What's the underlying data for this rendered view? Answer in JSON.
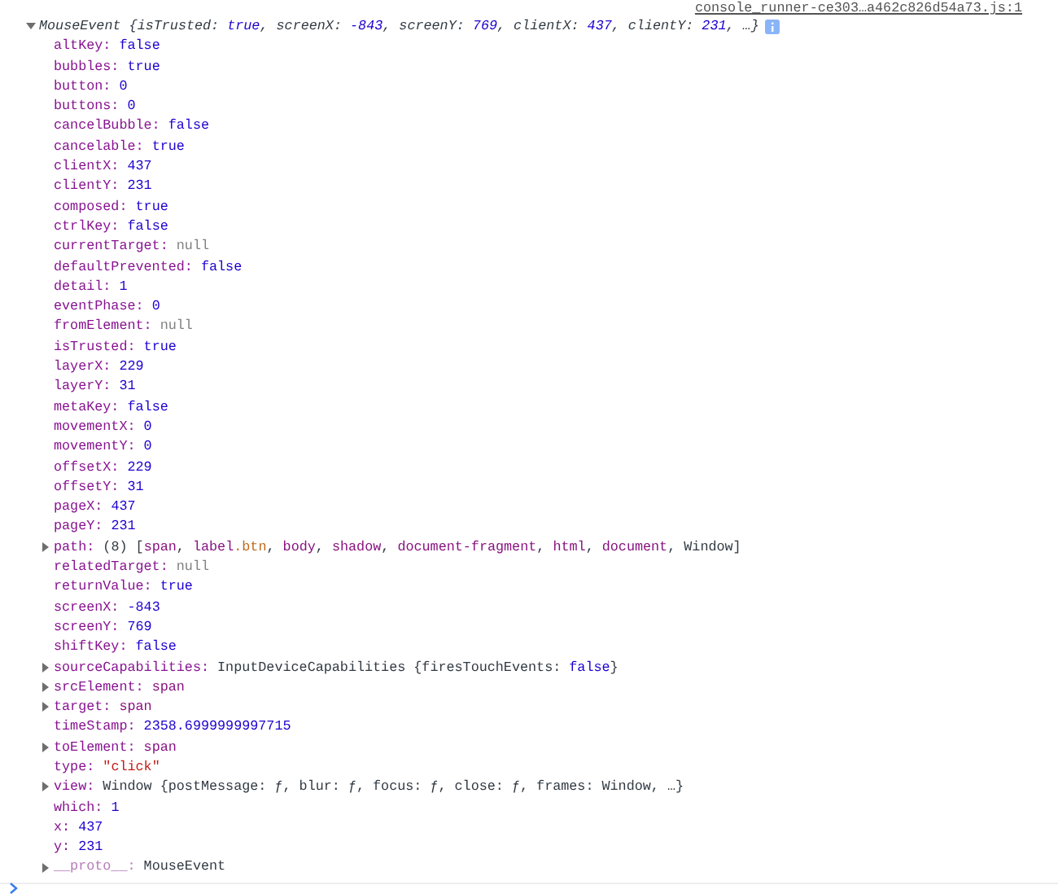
{
  "source_link": "console_runner-ce303…a462c826d54a73.js:1",
  "header": {
    "expanded": true,
    "parts": [
      {
        "text": "MouseEvent {",
        "kind": "plain"
      },
      {
        "text": "isTrusted: ",
        "kind": "plain"
      },
      {
        "text": "true",
        "kind": "number"
      },
      {
        "text": ", screenX: ",
        "kind": "plain"
      },
      {
        "text": "-843",
        "kind": "number"
      },
      {
        "text": ", screenY: ",
        "kind": "plain"
      },
      {
        "text": "769",
        "kind": "number"
      },
      {
        "text": ", clientX: ",
        "kind": "plain"
      },
      {
        "text": "437",
        "kind": "number"
      },
      {
        "text": ", clientY: ",
        "kind": "plain"
      },
      {
        "text": "231",
        "kind": "number"
      },
      {
        "text": ", …}",
        "kind": "plain"
      }
    ]
  },
  "properties": [
    {
      "key": "altKey:",
      "kind": "leaf",
      "parts": [
        {
          "text": "false",
          "kind": "number"
        }
      ]
    },
    {
      "key": "bubbles:",
      "kind": "leaf",
      "parts": [
        {
          "text": "true",
          "kind": "number"
        }
      ]
    },
    {
      "key": "button:",
      "kind": "leaf",
      "parts": [
        {
          "text": "0",
          "kind": "number"
        }
      ]
    },
    {
      "key": "buttons:",
      "kind": "leaf",
      "parts": [
        {
          "text": "0",
          "kind": "number"
        }
      ]
    },
    {
      "key": "cancelBubble:",
      "kind": "leaf",
      "parts": [
        {
          "text": "false",
          "kind": "number"
        }
      ]
    },
    {
      "key": "cancelable:",
      "kind": "leaf",
      "parts": [
        {
          "text": "true",
          "kind": "number"
        }
      ]
    },
    {
      "key": "clientX:",
      "kind": "leaf",
      "parts": [
        {
          "text": "437",
          "kind": "number"
        }
      ]
    },
    {
      "key": "clientY:",
      "kind": "leaf",
      "parts": [
        {
          "text": "231",
          "kind": "number"
        }
      ]
    },
    {
      "key": "composed:",
      "kind": "leaf",
      "parts": [
        {
          "text": "true",
          "kind": "number"
        }
      ]
    },
    {
      "key": "ctrlKey:",
      "kind": "leaf",
      "parts": [
        {
          "text": "false",
          "kind": "number"
        }
      ]
    },
    {
      "key": "currentTarget:",
      "kind": "leaf",
      "parts": [
        {
          "text": "null",
          "kind": "null"
        }
      ]
    },
    {
      "key": "defaultPrevented:",
      "kind": "leaf",
      "parts": [
        {
          "text": "false",
          "kind": "number"
        }
      ]
    },
    {
      "key": "detail:",
      "kind": "leaf",
      "parts": [
        {
          "text": "1",
          "kind": "number"
        }
      ]
    },
    {
      "key": "eventPhase:",
      "kind": "leaf",
      "parts": [
        {
          "text": "0",
          "kind": "number"
        }
      ]
    },
    {
      "key": "fromElement:",
      "kind": "leaf",
      "parts": [
        {
          "text": "null",
          "kind": "null"
        }
      ]
    },
    {
      "key": "isTrusted:",
      "kind": "leaf",
      "parts": [
        {
          "text": "true",
          "kind": "number"
        }
      ]
    },
    {
      "key": "layerX:",
      "kind": "leaf",
      "parts": [
        {
          "text": "229",
          "kind": "number"
        }
      ]
    },
    {
      "key": "layerY:",
      "kind": "leaf",
      "parts": [
        {
          "text": "31",
          "kind": "number"
        }
      ]
    },
    {
      "key": "metaKey:",
      "kind": "leaf",
      "parts": [
        {
          "text": "false",
          "kind": "number"
        }
      ]
    },
    {
      "key": "movementX:",
      "kind": "leaf",
      "parts": [
        {
          "text": "0",
          "kind": "number"
        }
      ]
    },
    {
      "key": "movementY:",
      "kind": "leaf",
      "parts": [
        {
          "text": "0",
          "kind": "number"
        }
      ]
    },
    {
      "key": "offsetX:",
      "kind": "leaf",
      "parts": [
        {
          "text": "229",
          "kind": "number"
        }
      ]
    },
    {
      "key": "offsetY:",
      "kind": "leaf",
      "parts": [
        {
          "text": "31",
          "kind": "number"
        }
      ]
    },
    {
      "key": "pageX:",
      "kind": "leaf",
      "parts": [
        {
          "text": "437",
          "kind": "number"
        }
      ]
    },
    {
      "key": "pageY:",
      "kind": "leaf",
      "parts": [
        {
          "text": "231",
          "kind": "number"
        }
      ]
    },
    {
      "key": "path:",
      "kind": "node",
      "expanded": false,
      "parts": [
        {
          "text": "(8) [",
          "kind": "plain"
        },
        {
          "text": "span",
          "kind": "tag"
        },
        {
          "text": ", ",
          "kind": "plain"
        },
        {
          "text": "label",
          "kind": "tag"
        },
        {
          "text": ".btn",
          "kind": "class"
        },
        {
          "text": ", ",
          "kind": "plain"
        },
        {
          "text": "body",
          "kind": "tag"
        },
        {
          "text": ", ",
          "kind": "plain"
        },
        {
          "text": "shadow",
          "kind": "tag"
        },
        {
          "text": ", ",
          "kind": "plain"
        },
        {
          "text": "document-fragment",
          "kind": "tag"
        },
        {
          "text": ", ",
          "kind": "plain"
        },
        {
          "text": "html",
          "kind": "tag"
        },
        {
          "text": ", ",
          "kind": "plain"
        },
        {
          "text": "document",
          "kind": "tag"
        },
        {
          "text": ", Window]",
          "kind": "plain"
        }
      ]
    },
    {
      "key": "relatedTarget:",
      "kind": "leaf",
      "parts": [
        {
          "text": "null",
          "kind": "null"
        }
      ]
    },
    {
      "key": "returnValue:",
      "kind": "leaf",
      "parts": [
        {
          "text": "true",
          "kind": "number"
        }
      ]
    },
    {
      "key": "screenX:",
      "kind": "leaf",
      "parts": [
        {
          "text": "-843",
          "kind": "number"
        }
      ]
    },
    {
      "key": "screenY:",
      "kind": "leaf",
      "parts": [
        {
          "text": "769",
          "kind": "number"
        }
      ]
    },
    {
      "key": "shiftKey:",
      "kind": "leaf",
      "parts": [
        {
          "text": "false",
          "kind": "number"
        }
      ]
    },
    {
      "key": "sourceCapabilities:",
      "kind": "node",
      "expanded": false,
      "parts": [
        {
          "text": "InputDeviceCapabilities {firesTouchEvents: ",
          "kind": "plain"
        },
        {
          "text": "false",
          "kind": "number"
        },
        {
          "text": "}",
          "kind": "plain"
        }
      ]
    },
    {
      "key": "srcElement:",
      "kind": "node",
      "expanded": false,
      "parts": [
        {
          "text": "span",
          "kind": "tag"
        }
      ]
    },
    {
      "key": "target:",
      "kind": "node",
      "expanded": false,
      "parts": [
        {
          "text": "span",
          "kind": "tag"
        }
      ]
    },
    {
      "key": "timeStamp:",
      "kind": "leaf",
      "parts": [
        {
          "text": "2358.6999999997715",
          "kind": "number"
        }
      ]
    },
    {
      "key": "toElement:",
      "kind": "node",
      "expanded": false,
      "parts": [
        {
          "text": "span",
          "kind": "tag"
        }
      ]
    },
    {
      "key": "type:",
      "kind": "leaf",
      "parts": [
        {
          "text": "\"click\"",
          "kind": "string"
        }
      ]
    },
    {
      "key": "view:",
      "kind": "node",
      "expanded": false,
      "parts": [
        {
          "text": "Window {postMessage: ƒ, blur: ƒ, focus: ƒ, close: ƒ, frames: Window, …}",
          "kind": "plain"
        }
      ]
    },
    {
      "key": "which:",
      "kind": "leaf",
      "parts": [
        {
          "text": "1",
          "kind": "number"
        }
      ]
    },
    {
      "key": "x:",
      "kind": "leaf",
      "parts": [
        {
          "text": "437",
          "kind": "number"
        }
      ]
    },
    {
      "key": "y:",
      "kind": "leaf",
      "parts": [
        {
          "text": "231",
          "kind": "number"
        }
      ]
    },
    {
      "key": "__proto__:",
      "kind": "node",
      "expanded": false,
      "dim": true,
      "parts": [
        {
          "text": "MouseEvent",
          "kind": "plain"
        }
      ]
    }
  ]
}
